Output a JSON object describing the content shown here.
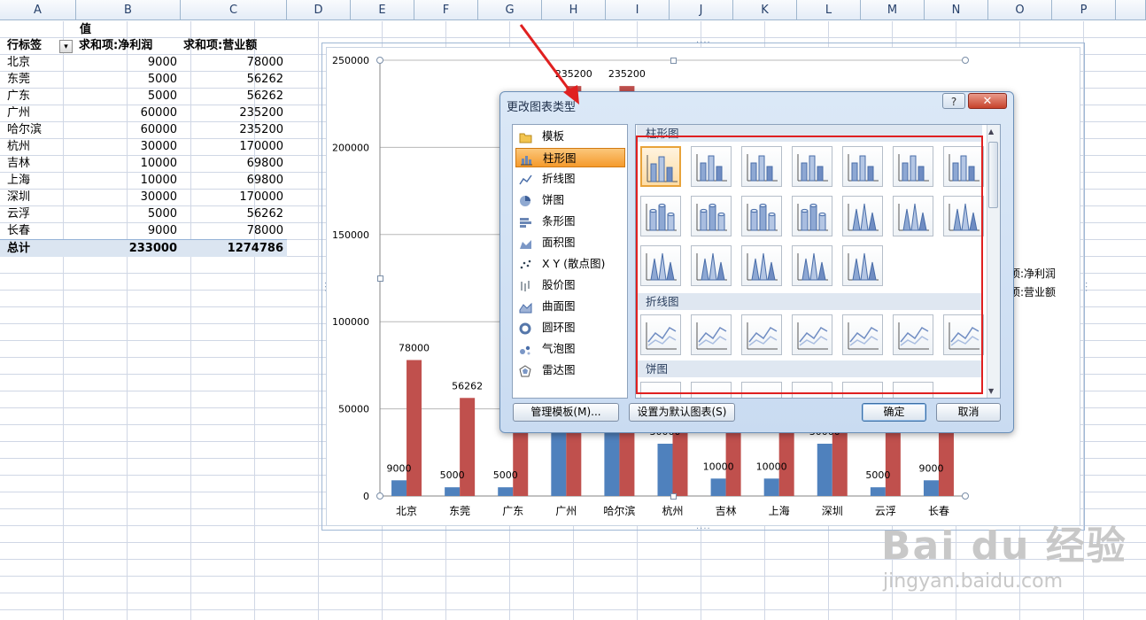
{
  "sheet": {
    "columns": [
      "A",
      "B",
      "C",
      "D",
      "E",
      "F",
      "G",
      "H",
      "I",
      "J",
      "K",
      "L",
      "M",
      "N",
      "O",
      "P"
    ],
    "pivot": {
      "header_values": "值",
      "row_label": "行标签",
      "col_b": "求和项:净利润",
      "col_c": "求和项:营业额",
      "rows": [
        {
          "city": "北京",
          "profit": "9000",
          "revenue": "78000"
        },
        {
          "city": "东莞",
          "profit": "5000",
          "revenue": "56262"
        },
        {
          "city": "广东",
          "profit": "5000",
          "revenue": "56262"
        },
        {
          "city": "广州",
          "profit": "60000",
          "revenue": "235200"
        },
        {
          "city": "哈尔滨",
          "profit": "60000",
          "revenue": "235200"
        },
        {
          "city": "杭州",
          "profit": "30000",
          "revenue": "170000"
        },
        {
          "city": "吉林",
          "profit": "10000",
          "revenue": "69800"
        },
        {
          "city": "上海",
          "profit": "10000",
          "revenue": "69800"
        },
        {
          "city": "深圳",
          "profit": "30000",
          "revenue": "170000"
        },
        {
          "city": "云浮",
          "profit": "5000",
          "revenue": "56262"
        },
        {
          "city": "长春",
          "profit": "9000",
          "revenue": "78000"
        }
      ],
      "total": {
        "label": "总计",
        "profit": "233000",
        "revenue": "1274786"
      }
    }
  },
  "chart_data": {
    "type": "bar",
    "categories": [
      "北京",
      "东莞",
      "广东",
      "广州",
      "哈尔滨",
      "杭州",
      "吉林",
      "上海",
      "深圳",
      "云浮",
      "长春"
    ],
    "series": [
      {
        "values": [
          9000,
          5000,
          5000,
          60000,
          60000,
          30000,
          10000,
          10000,
          30000,
          5000,
          9000
        ],
        "color": "#4f81bd"
      },
      {
        "values": [
          78000,
          56262,
          56262,
          235200,
          235200,
          170000,
          69800,
          69800,
          170000,
          56262,
          78000
        ],
        "color": "#c0504d"
      }
    ],
    "ylim": [
      0,
      250000
    ],
    "yticks": [
      "0",
      "50000",
      "100000",
      "150000",
      "200000",
      "250000"
    ],
    "legend_labels": [
      "项:净利润",
      "项:营业额"
    ],
    "visible_series1_labels": [
      "9000",
      "5000",
      "5000",
      "",
      "",
      "30000",
      "10000",
      "10000",
      "30000",
      "5000",
      "9000"
    ],
    "visible_series2_labels": [
      "78000",
      "56262",
      "",
      "235200",
      "235200",
      "",
      "",
      "",
      "",
      "",
      ""
    ],
    "grid": true
  },
  "dialog": {
    "title": "更改图表类型",
    "help_label": "?",
    "close_label": "✕",
    "categories": [
      {
        "label": "模板",
        "icon": "folder-icon"
      },
      {
        "label": "柱形图",
        "icon": "column-chart-icon",
        "selected": true
      },
      {
        "label": "折线图",
        "icon": "line-chart-icon"
      },
      {
        "label": "饼图",
        "icon": "pie-chart-icon"
      },
      {
        "label": "条形图",
        "icon": "bar-chart-icon"
      },
      {
        "label": "面积图",
        "icon": "area-chart-icon"
      },
      {
        "label": "X Y (散点图)",
        "icon": "scatter-chart-icon"
      },
      {
        "label": "股价图",
        "icon": "stock-chart-icon"
      },
      {
        "label": "曲面图",
        "icon": "surface-chart-icon"
      },
      {
        "label": "圆环图",
        "icon": "doughnut-chart-icon"
      },
      {
        "label": "气泡图",
        "icon": "bubble-chart-icon"
      },
      {
        "label": "雷达图",
        "icon": "radar-chart-icon"
      }
    ],
    "sections": {
      "column": "柱形图",
      "line": "折线图",
      "pie": "饼图"
    },
    "buttons": {
      "manage": "管理模板(M)...",
      "set_default": "设置为默认图表(S)",
      "ok": "确定",
      "cancel": "取消"
    }
  },
  "watermark": {
    "brand": "Bai du 经验",
    "url": "jingyan.baidu.com"
  }
}
